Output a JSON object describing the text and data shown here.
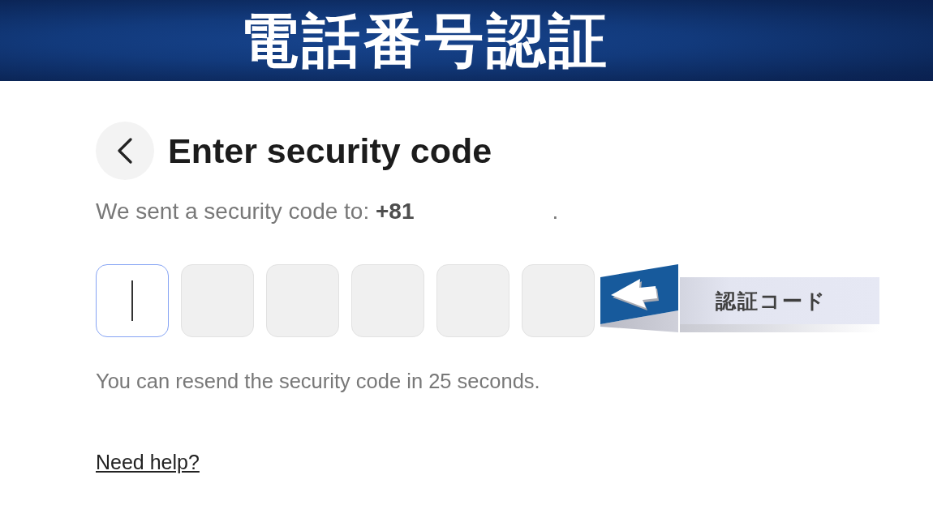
{
  "banner": {
    "title": "電話番号認証"
  },
  "header": {
    "title": "Enter security code"
  },
  "message": {
    "text": "We sent a security code to: **+81**",
    "suffix": "."
  },
  "code_boxes": [
    {
      "focused": true
    },
    {
      "focused": false
    },
    {
      "focused": false
    },
    {
      "focused": false
    },
    {
      "focused": false
    },
    {
      "focused": false
    }
  ],
  "callout": {
    "label": "認証コード"
  },
  "resend_notice": "You can resend the security code in 25 seconds.",
  "help_link": "Need help?"
}
